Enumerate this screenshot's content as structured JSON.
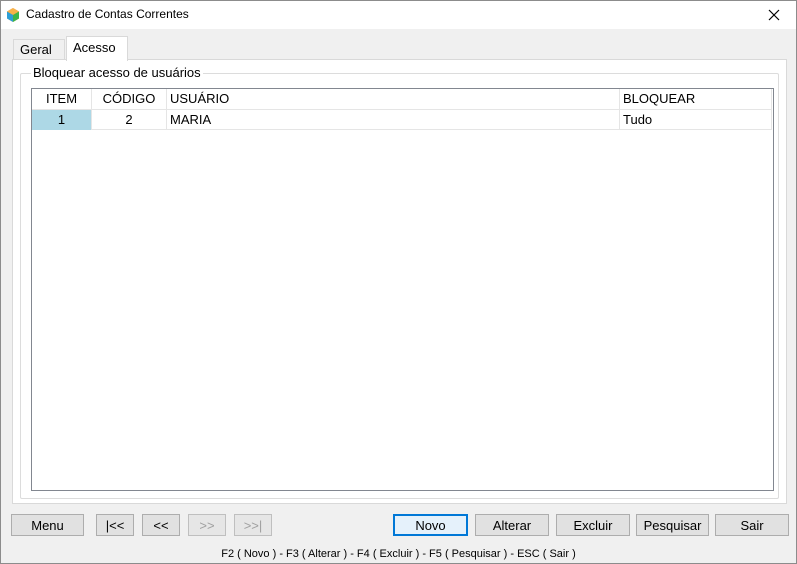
{
  "window": {
    "title": "Cadastro de Contas Correntes",
    "close_glyph": "close-icon",
    "app_icon": "app-logo-icon"
  },
  "tabs": [
    {
      "label": "Geral",
      "active": false
    },
    {
      "label": "Acesso",
      "active": true
    }
  ],
  "group": {
    "legend": "Bloquear acesso de usuários"
  },
  "grid": {
    "columns": [
      "ITEM",
      "CÓDIGO",
      "USUÁRIO",
      "BLOQUEAR"
    ],
    "rows": [
      {
        "item": "1",
        "codigo": "2",
        "usuario": "MARIA",
        "bloquear": "Tudo"
      }
    ]
  },
  "buttons": {
    "menu": "Menu",
    "first": "|<<",
    "prev": "<<",
    "next": ">>",
    "last": ">>|",
    "novo": "Novo",
    "alterar": "Alterar",
    "excluir": "Excluir",
    "pesquisar": "Pesquisar",
    "sair": "Sair"
  },
  "statusbar": {
    "shortcuts": "F2 ( Novo )  -  F3 ( Alterar )  -  F4 ( Excluir )  -  F5 ( Pesquisar )  -  ESC ( Sair )"
  },
  "colors": {
    "selected_cell": "#add8e6",
    "default_button_border": "#0078d7"
  }
}
